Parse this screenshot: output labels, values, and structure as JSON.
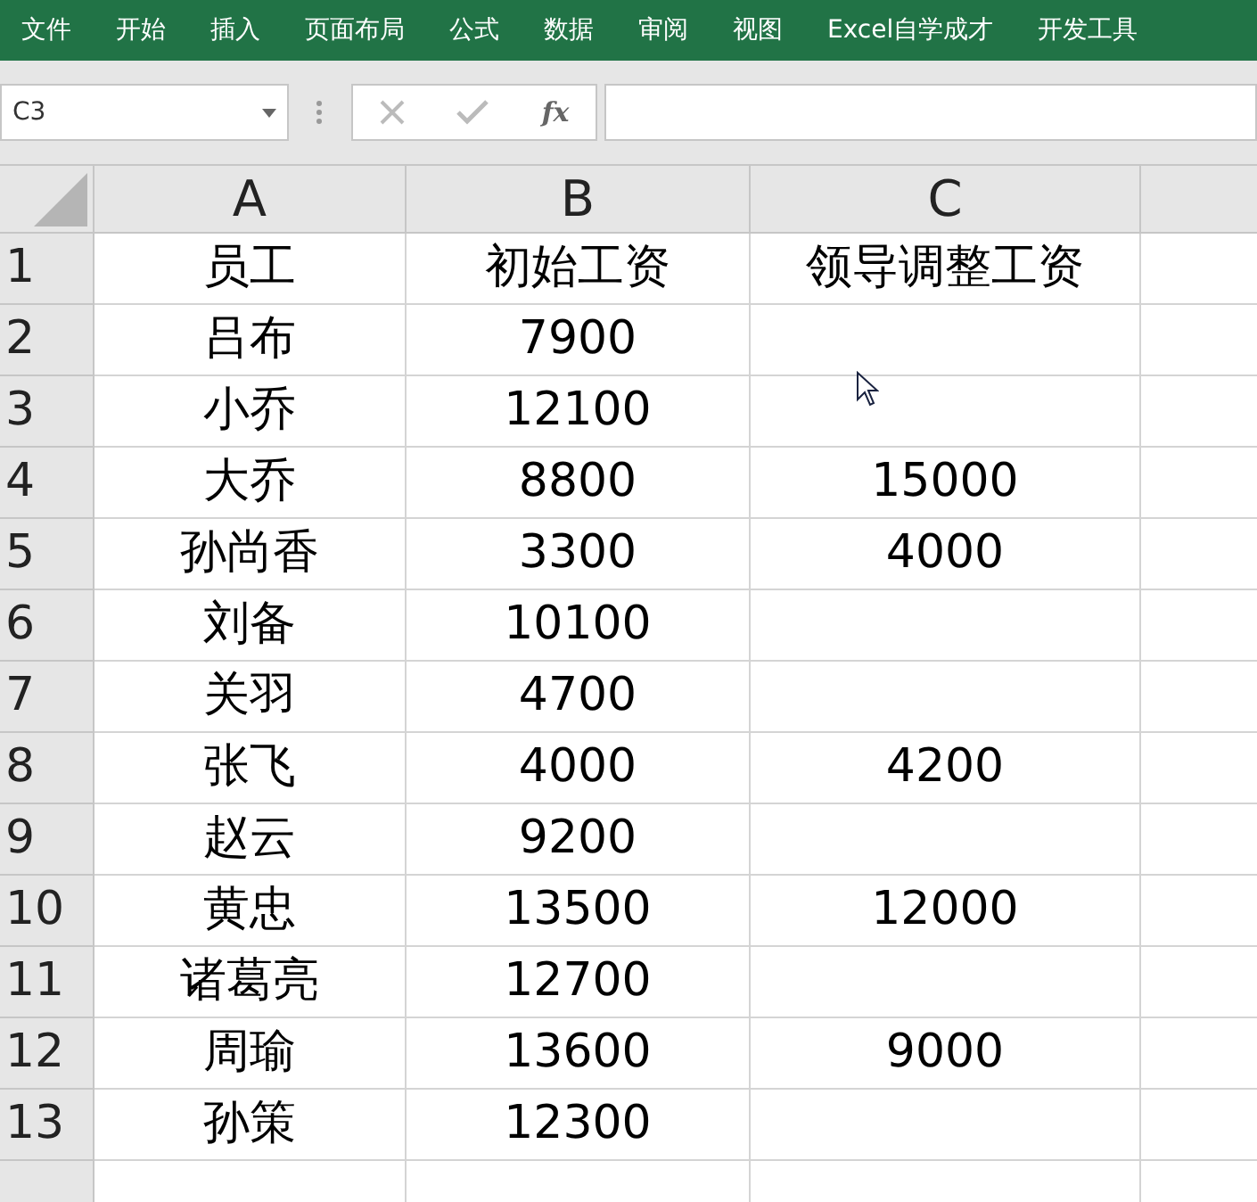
{
  "ribbon_tabs": [
    "文件",
    "开始",
    "插入",
    "页面布局",
    "公式",
    "数据",
    "审阅",
    "视图",
    "Excel自学成才",
    "开发工具"
  ],
  "name_box": {
    "value": "C3"
  },
  "formula_bar": {
    "function_label": "fx"
  },
  "columns": [
    "A",
    "B",
    "C"
  ],
  "rows": [
    {
      "number": "1",
      "cells": [
        "员工",
        "初始工资",
        "领导调整工资"
      ]
    },
    {
      "number": "2",
      "cells": [
        "吕布",
        "7900",
        null
      ]
    },
    {
      "number": "3",
      "cells": [
        "小乔",
        "12100",
        null
      ]
    },
    {
      "number": "4",
      "cells": [
        "大乔",
        "8800",
        "15000"
      ]
    },
    {
      "number": "5",
      "cells": [
        "孙尚香",
        "3300",
        "4000"
      ]
    },
    {
      "number": "6",
      "cells": [
        "刘备",
        "10100",
        null
      ]
    },
    {
      "number": "7",
      "cells": [
        "关羽",
        "4700",
        null
      ]
    },
    {
      "number": "8",
      "cells": [
        "张飞",
        "4000",
        "4200"
      ]
    },
    {
      "number": "9",
      "cells": [
        "赵云",
        "9200",
        null
      ]
    },
    {
      "number": "10",
      "cells": [
        "黄忠",
        "13500",
        "12000"
      ]
    },
    {
      "number": "11",
      "cells": [
        "诸葛亮",
        "12700",
        null
      ]
    },
    {
      "number": "12",
      "cells": [
        "周瑜",
        "13600",
        "9000"
      ]
    },
    {
      "number": "13",
      "cells": [
        "孙策",
        "12300",
        null
      ]
    }
  ]
}
